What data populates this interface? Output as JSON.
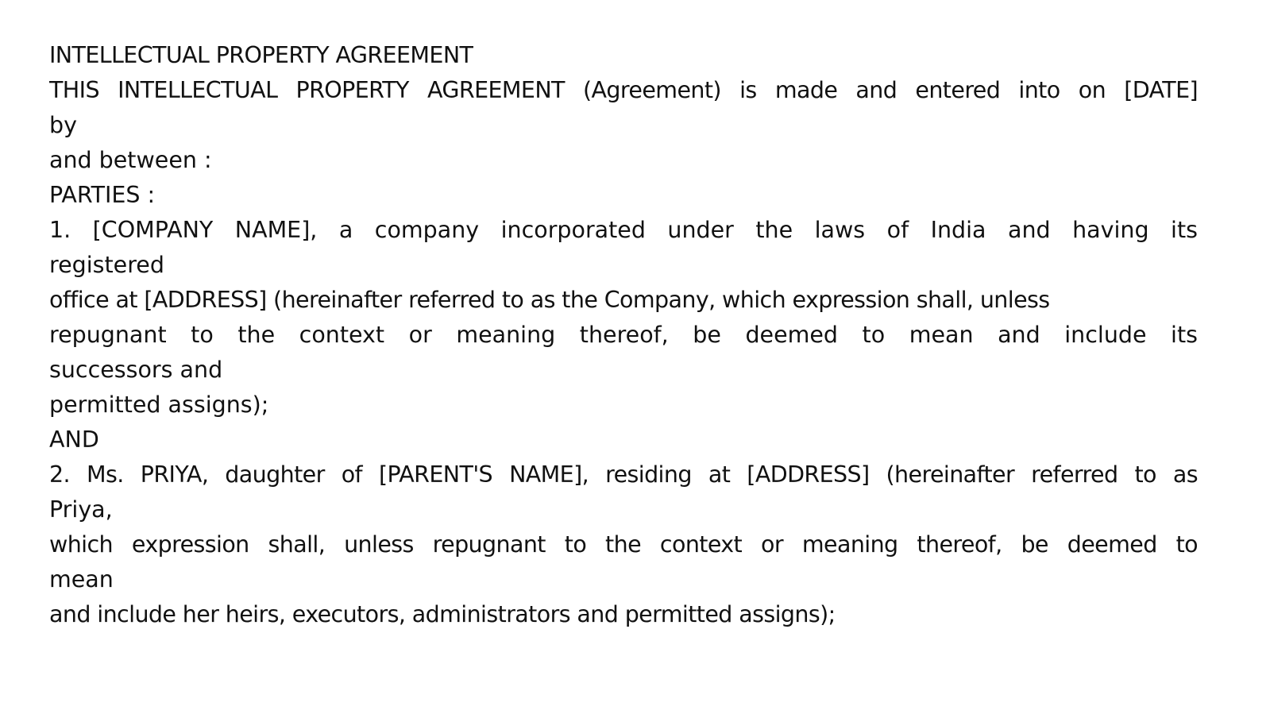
{
  "document": {
    "title": "INTELLECTUAL PROPERTY AGREEMENT",
    "lines": [
      "THIS INTELLECTUAL PROPERTY AGREEMENT (Agreement) is made and entered into on [DATE]",
      "by",
      "and between :",
      "PARTIES :",
      "1. [COMPANY NAME], a company incorporated under the laws of India and having its",
      "registered",
      "office at [ADDRESS] (hereinafter referred to as the Company, which expression shall, unless",
      "repugnant to the context or meaning thereof, be deemed to mean and include its",
      "successors and",
      "permitted assigns);",
      "AND",
      "2. Ms. PRIYA, daughter of [PARENT'S NAME], residing at [ADDRESS] (hereinafter referred to as",
      "Priya,",
      "which expression shall, unless repugnant to the context or meaning thereof, be deemed to",
      "mean",
      "and include her heirs, executors, administrators and permitted assigns);"
    ]
  }
}
